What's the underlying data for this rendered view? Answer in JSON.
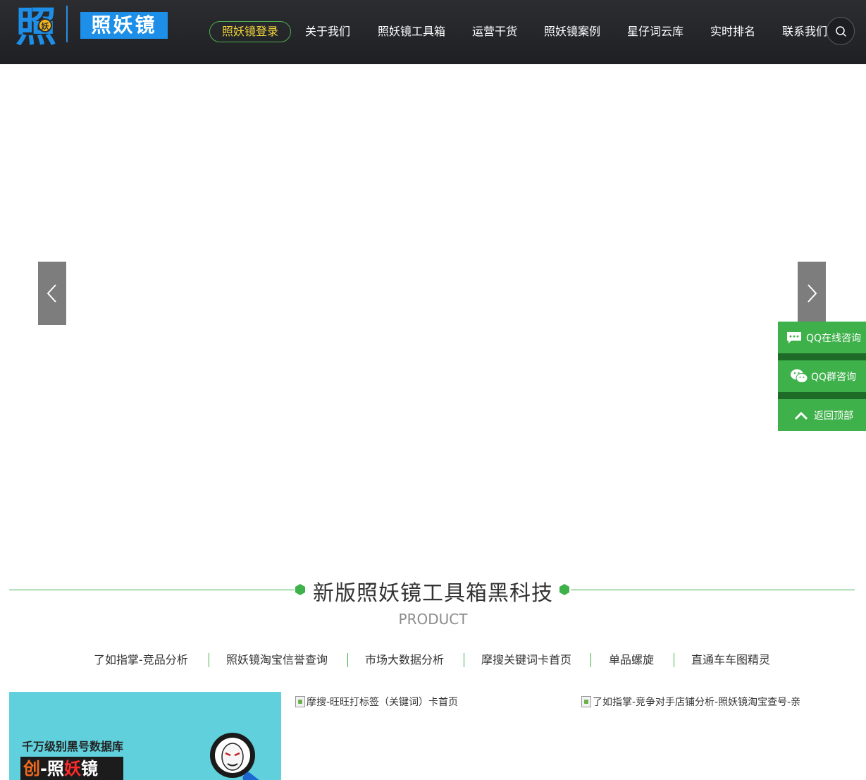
{
  "header": {
    "logo_char": "照",
    "logo_badge": "妖",
    "logo_text": "照妖镜",
    "nav": [
      {
        "label": "照妖镜登录",
        "active": true
      },
      {
        "label": "关于我们"
      },
      {
        "label": "照妖镜工具箱"
      },
      {
        "label": "运营干货"
      },
      {
        "label": "照妖镜案例"
      },
      {
        "label": "星仔词云库"
      },
      {
        "label": "实时排名"
      },
      {
        "label": "联系我们"
      }
    ],
    "search_icon": "search-icon"
  },
  "banner": {
    "prev_icon": "chevron-left-icon",
    "next_icon": "chevron-right-icon"
  },
  "side": {
    "qq_online": "QQ在线咨询",
    "qq_group": "QQ群咨询",
    "back_top": "返回顶部"
  },
  "section": {
    "title": "新版照妖镜工具箱黑科技",
    "subtitle": "PRODUCT",
    "categories": [
      "了如指掌-竞品分析",
      "照妖镜淘宝信誉查询",
      "市场大数据分析",
      "摩搜关键词卡首页",
      "单品螺旋",
      "直通车车图精灵"
    ]
  },
  "products": {
    "p1_line1": "千万级别黑号数据库",
    "p1_chuang": "创",
    "p1_dash": "-",
    "p1_zhao": "照",
    "p1_yao": "妖",
    "p1_jing": "镜",
    "p2_alt": "摩搜-旺旺打标签（关键词）卡首页",
    "p3_alt": "了如指掌-竞争对手店铺分析-照妖镜淘宝查号-亲"
  },
  "colors": {
    "accent_green": "#3fb14b",
    "header_bg": "#26272b",
    "active_nav_text": "#f2d63b",
    "logo_blue": "#1e8fe8"
  }
}
